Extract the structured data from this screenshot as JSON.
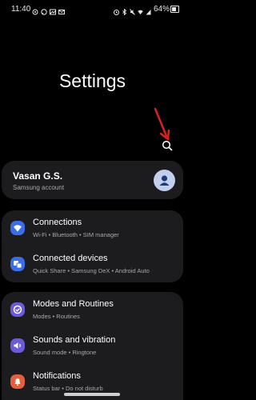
{
  "status_bar": {
    "time": "11:40",
    "battery": "64%",
    "left_icons": [
      "at-sign-icon",
      "chat-icon",
      "image-icon",
      "mail-icon"
    ],
    "right_icons": [
      "alarm-icon",
      "bluetooth-icon",
      "mute-icon",
      "wifi-icon",
      "signal-icon"
    ]
  },
  "page": {
    "title": "Settings"
  },
  "search": {
    "icon": "search-icon"
  },
  "profile": {
    "name": "Vasan G.S.",
    "subtitle": "Samsung account"
  },
  "groups": [
    {
      "items": [
        {
          "title": "Connections",
          "subtitle": "Wi-Fi • Bluetooth • SIM manager",
          "icon": "wifi-icon",
          "color": "#3a6ee8"
        },
        {
          "title": "Connected devices",
          "subtitle": "Quick Share • Samsung DeX • Android Auto",
          "icon": "connected-devices-icon",
          "color": "#3a6ee8"
        }
      ]
    },
    {
      "items": [
        {
          "title": "Modes and Routines",
          "subtitle": "Modes • Routines",
          "icon": "check-circle-icon",
          "color": "#6a5bd6"
        },
        {
          "title": "Sounds and vibration",
          "subtitle": "Sound mode • Ringtone",
          "icon": "sound-icon",
          "color": "#6a5bd6"
        },
        {
          "title": "Notifications",
          "subtitle": "Status bar • Do not disturb",
          "icon": "bell-icon",
          "color": "#e2603c"
        }
      ]
    }
  ],
  "colors": {
    "background": "#000000",
    "card": "#1c1c1e",
    "subtext": "#a8a8ac",
    "annotation_arrow": "#e0221f",
    "avatar": "#c2d0ef"
  }
}
